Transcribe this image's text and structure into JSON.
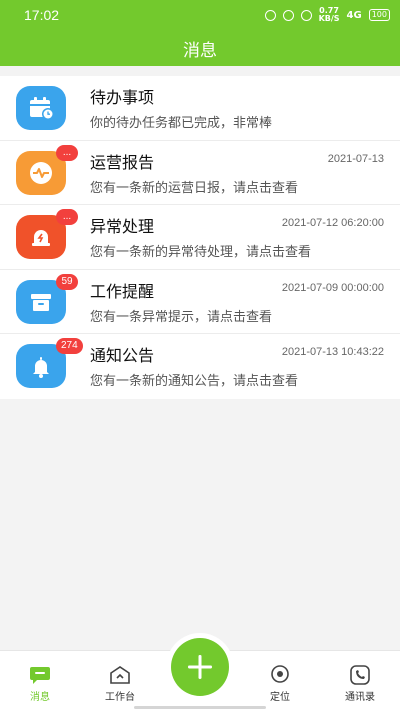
{
  "status_bar": {
    "time": "17:02",
    "speed_value": "0.77",
    "speed_unit": "KB/S",
    "signal": "4G",
    "battery": "100"
  },
  "header": {
    "title": "消息"
  },
  "messages": [
    {
      "title": "待办事项",
      "date": "",
      "desc": "你的待办任务都已完成，非常棒",
      "badge": "",
      "icon": "calendar-icon",
      "color": "#3aa4ec"
    },
    {
      "title": "运营报告",
      "date": "2021-07-13",
      "desc": "您有一条新的运营日报，请点击查看",
      "badge": "...",
      "icon": "heartbeat-icon",
      "color": "#f79b36"
    },
    {
      "title": "异常处理",
      "date": "2021-07-12 06:20:00",
      "desc": "您有一条新的异常待处理，请点击查看",
      "badge": "...",
      "icon": "alarm-icon",
      "color": "#f0522a"
    },
    {
      "title": "工作提醒",
      "date": "2021-07-09 00:00:00",
      "desc": "您有一条异常提示，请点击查看",
      "badge": "59",
      "icon": "briefcase-icon",
      "color": "#3aa4ec"
    },
    {
      "title": "通知公告",
      "date": "2021-07-13 10:43:22",
      "desc": "您有一条新的通知公告，请点击查看",
      "badge": "274",
      "icon": "bell-icon",
      "color": "#3aa4ec"
    }
  ],
  "tabbar": {
    "messages": "消息",
    "workbench": "工作台",
    "location": "定位",
    "contacts": "通讯录"
  },
  "colors": {
    "primary": "#73c92d",
    "badge": "#f2403d"
  }
}
